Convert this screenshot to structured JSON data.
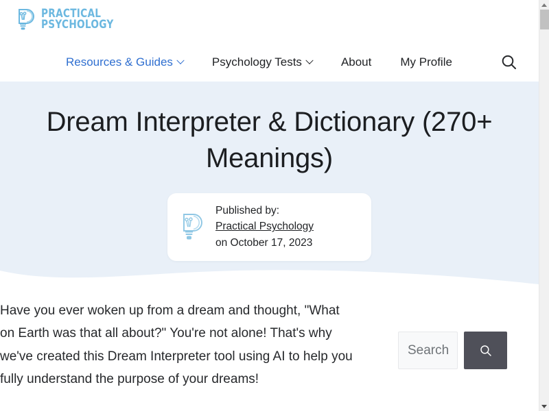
{
  "header": {
    "logo": {
      "icon": "lightbulb-p-logo-icon",
      "line1": "PRACTICAL",
      "line2": "PSYCHOLOGY",
      "color": "#6cb8e0"
    },
    "nav": [
      {
        "label": "Resources & Guides",
        "has_dropdown": true,
        "active": true
      },
      {
        "label": "Psychology Tests",
        "has_dropdown": true,
        "active": false
      },
      {
        "label": "About",
        "has_dropdown": false,
        "active": false
      },
      {
        "label": "My Profile",
        "has_dropdown": false,
        "active": false
      }
    ],
    "search_icon": "search-icon",
    "active_color": "#2f6fd0"
  },
  "hero": {
    "background_color": "#e9f0f8",
    "title": "Dream Interpreter & Dictionary (270+ Meanings)",
    "author_card": {
      "icon": "lightbulb-p-avatar-icon",
      "published_label": "Published by:",
      "author_name": "Practical Psychology",
      "date_line": "on October 17, 2023"
    }
  },
  "article": {
    "intro_paragraph": "Have you ever woken up from a dream and thought, \"What on Earth was that all about?\" You're not alone! That's why we've created this Dream Interpreter tool using AI to help you fully understand the purpose of your dreams!"
  },
  "search_widget": {
    "placeholder": "Search",
    "value": "",
    "button_icon": "search-icon",
    "button_color": "#4f5059"
  },
  "scrollbar": {
    "up_arrow": "scroll-up-arrow-icon",
    "down_arrow": "scroll-down-arrow-icon",
    "track_color": "#f1f1f1",
    "thumb_color": "#c1c1c1"
  }
}
